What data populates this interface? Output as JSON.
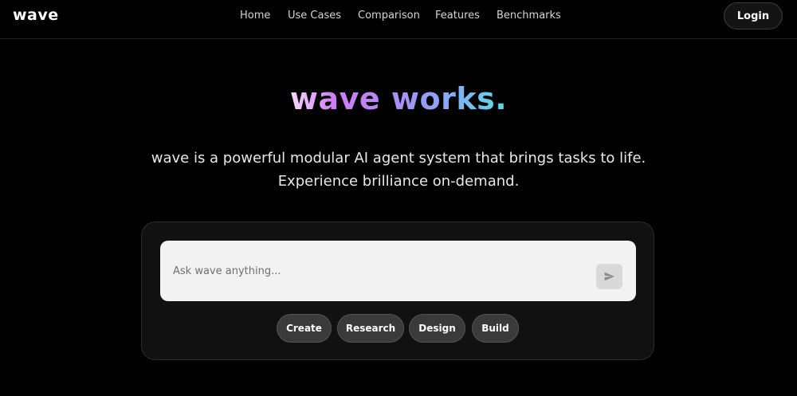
{
  "brand": {
    "logo_text": "wave"
  },
  "nav": {
    "items": [
      {
        "label": "Home"
      },
      {
        "label": "Use Cases"
      },
      {
        "label": "Comparison"
      },
      {
        "label": "Features"
      },
      {
        "label": "Benchmarks"
      }
    ],
    "login_label": "Login"
  },
  "hero": {
    "title": "wave works.",
    "subtitle_line1": "wave is a powerful modular AI agent system that brings tasks to life.",
    "subtitle_line2": "Experience brilliance on-demand."
  },
  "prompt": {
    "placeholder": "Ask wave anything...",
    "value": "",
    "send_icon": "send-icon"
  },
  "actions": [
    {
      "label": "Create"
    },
    {
      "label": "Research"
    },
    {
      "label": "Design"
    },
    {
      "label": "Build"
    }
  ],
  "colors": {
    "background": "#000000",
    "card": "#111111",
    "input_bg": "#f2f2f2",
    "chip_bg": "#3a3a3a",
    "title_gradient": [
      "#f3d9ff",
      "#d07cf5",
      "#b08af5",
      "#8fa3f5",
      "#6ec6ef",
      "#4fe0e6"
    ]
  }
}
